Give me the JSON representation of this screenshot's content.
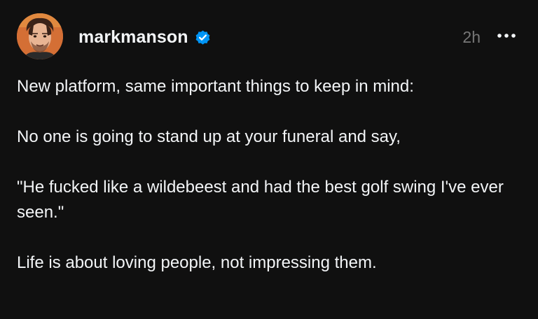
{
  "post": {
    "author": {
      "username": "markmanson",
      "verified": true,
      "avatar_icon": "avatar-photo"
    },
    "timestamp": "2h",
    "more_icon": "more-options-icon",
    "paragraphs": [
      "New platform, same important things to keep in mind:",
      "No one is going to stand up at your funeral and say,",
      "\"He fucked like a wildebeest and had the best golf swing I've ever seen.\"",
      "Life is about loving people, not impressing them."
    ]
  },
  "colors": {
    "background": "#101010",
    "text": "#f3f5f7",
    "muted": "#777777",
    "verified_badge": "#0095f6"
  }
}
